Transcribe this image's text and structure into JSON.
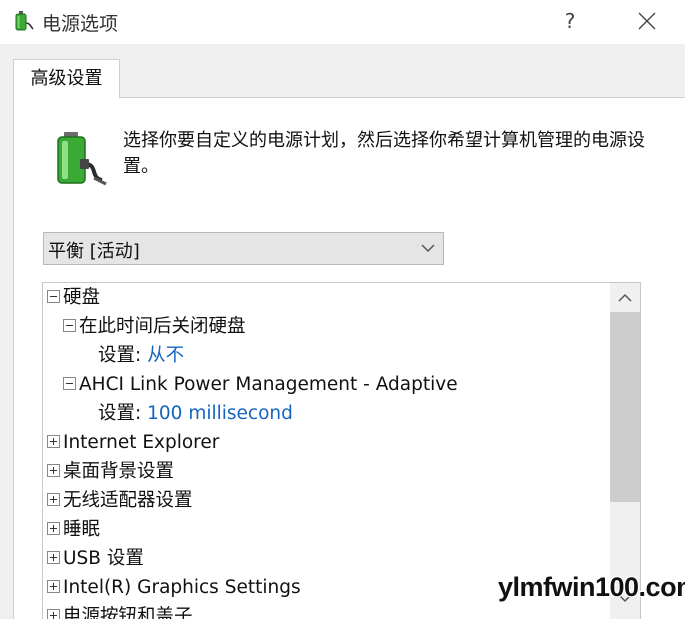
{
  "window": {
    "title": "电源选项",
    "help_label": "?",
    "close_label": "✕"
  },
  "tabs": [
    {
      "label": "高级设置"
    }
  ],
  "intro_text": "选择你要自定义的电源计划，然后选择你希望计算机管理的电源设置。",
  "plan_select": {
    "value": "平衡 [活动]"
  },
  "tree": [
    {
      "label": "硬盘",
      "expander": "minus"
    },
    {
      "label": "在此时间后关闭硬盘",
      "expander": "minus"
    },
    {
      "label": "设置:",
      "value": "从不"
    },
    {
      "label": "AHCI Link Power Management - Adaptive",
      "expander": "minus"
    },
    {
      "label": "设置:",
      "value": "100 millisecond"
    },
    {
      "label": "Internet Explorer",
      "expander": "plus"
    },
    {
      "label": "桌面背景设置",
      "expander": "plus"
    },
    {
      "label": "无线适配器设置",
      "expander": "plus"
    },
    {
      "label": "睡眠",
      "expander": "plus"
    },
    {
      "label": "USB 设置",
      "expander": "plus"
    },
    {
      "label": "Intel(R) Graphics Settings",
      "expander": "plus"
    },
    {
      "label": "电源按钮和盖子",
      "expander": "plus"
    }
  ],
  "watermark": "ylmfwin100.com",
  "icons": {
    "app": "power-options-icon",
    "help": "help-icon",
    "close": "close-icon",
    "dropdown": "chevron-down-icon",
    "scroll_up": "chevron-up-icon",
    "scroll_down": "chevron-down-icon",
    "power_plan": "battery-plug-icon"
  },
  "colors": {
    "value_text": "#1565c0",
    "battery_green": "#3aa935"
  }
}
